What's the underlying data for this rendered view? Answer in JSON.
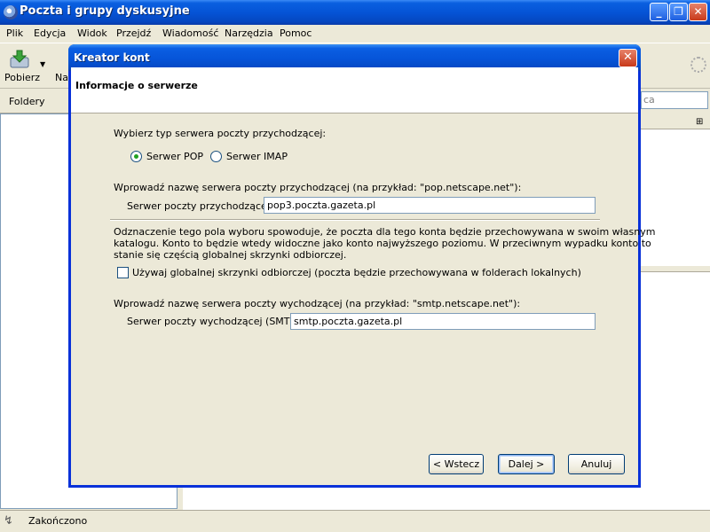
{
  "window": {
    "title": "Poczta i grupy dyskusyjne",
    "minimize": "_",
    "maximize": "❐",
    "close": "✕"
  },
  "menu": [
    "Plik",
    "Edycja",
    "Widok",
    "Przejdź",
    "Wiadomość",
    "Narzędzia",
    "Pomoc"
  ],
  "toolbar": {
    "get_label": "Pobierz",
    "get_dropdown": "▼",
    "partial_label": "Na"
  },
  "folders_label": "Foldery",
  "search_partial": "ca",
  "column_picker": "⊞",
  "status": {
    "icon": "online-icon",
    "text": "Zakończono"
  },
  "dialog": {
    "title": "Kreator kont",
    "close": "✕",
    "header_title": "Informacje o serwerze",
    "incoming_type_label": "Wybierz typ serwera poczty przychodzącej:",
    "radio_pop": "Serwer POP",
    "radio_imap": "Serwer IMAP",
    "selected_type": "pop",
    "incoming_hint": "Wprowadź nazwę serwera poczty przychodzącej (na przykład: \"pop.netscape.net\"):",
    "incoming_label": "Serwer poczty przychodzącej:",
    "incoming_value": "pop3.poczta.gazeta.pl",
    "info_line1": "Odznaczenie tego pola wyboru spowoduje, że poczta dla tego konta będzie przechowywana w swoim własnym",
    "info_line2": "katalogu. Konto to będzie wtedy widoczne jako konto najwyższego poziomu. W przeciwnym wypadku konto to",
    "info_line3": "stanie się częścią globalnej skrzynki odbiorczej.",
    "global_inbox_label": "Używaj globalnej skrzynki odbiorczej (poczta będzie przechowywana w folderach lokalnych)",
    "global_inbox_checked": false,
    "outgoing_hint": "Wprowadź nazwę serwera poczty wychodzącej (na przykład: \"smtp.netscape.net\"):",
    "outgoing_label": "Serwer poczty wychodzącej (SMTP):",
    "outgoing_value": "smtp.poczta.gazeta.pl",
    "back_button": "< Wstecz",
    "next_button": "Dalej >",
    "cancel_button": "Anuluj"
  }
}
